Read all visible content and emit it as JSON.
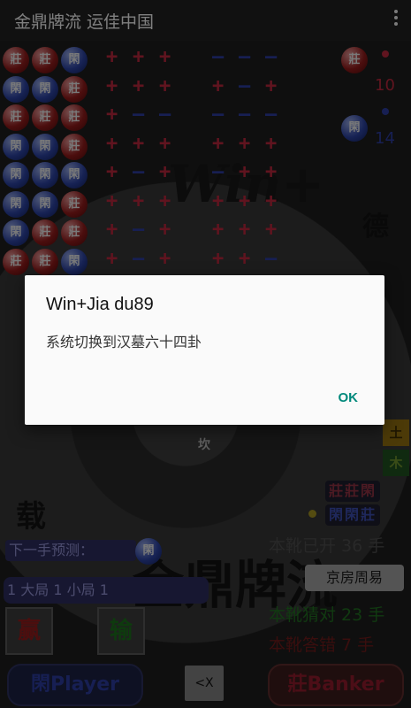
{
  "app": {
    "title": "金鼎牌流 运佳中国"
  },
  "board": {
    "red_count": "10",
    "blue_count": "14",
    "coin_banker_text": "莊",
    "coin_player_text": "閑",
    "coin_rows": [
      [
        "p",
        "p",
        "b"
      ],
      [
        "b",
        "b",
        "p"
      ],
      [
        "p",
        "p",
        "p"
      ],
      [
        "b",
        "b",
        "p"
      ],
      [
        "b",
        "b",
        "b"
      ],
      [
        "b",
        "b",
        "p"
      ],
      [
        "b",
        "p",
        "p"
      ],
      [
        "p",
        "p",
        "b"
      ]
    ],
    "sign_rows": [
      [
        "+++",
        "---"
      ],
      [
        "+++",
        "+-+"
      ],
      [
        "+--",
        "---"
      ],
      [
        "+++",
        "+++"
      ],
      [
        "+-+",
        "-++"
      ],
      [
        "+++",
        "+++"
      ],
      [
        "+-+",
        "+++"
      ],
      [
        "+-+",
        "++-"
      ]
    ],
    "watermark_logo": "Win+",
    "watermark_de": "德",
    "watermark_zai": "载",
    "watermark_brand": "金鼎牌流",
    "bagua_center": "坎",
    "earth_label": "土",
    "wood_label": "木",
    "pattern_row1": "莊莊閑",
    "pattern_row2": "閑閑莊",
    "next_label": "下一手预测：",
    "predict_coin": "閑",
    "round_text": "1 大局 1 小局   1",
    "stat_opened": "本靴已开 36 手",
    "zhou_button": "京房周易",
    "stat_right": "本靴猜对 23 手",
    "stat_wrong": "本靴答错 7 手",
    "win_label": "赢",
    "lose_label": "输",
    "player_button": "閑Player",
    "banker_button": "莊Banker",
    "undo_button": "<X"
  },
  "colors": {
    "red": "#b0263a",
    "blue": "#2a3a98",
    "accent": "#00897b"
  },
  "dialog": {
    "title": "Win+Jia du89",
    "message": "系统切换到汉墓六十四卦",
    "ok": "OK"
  }
}
